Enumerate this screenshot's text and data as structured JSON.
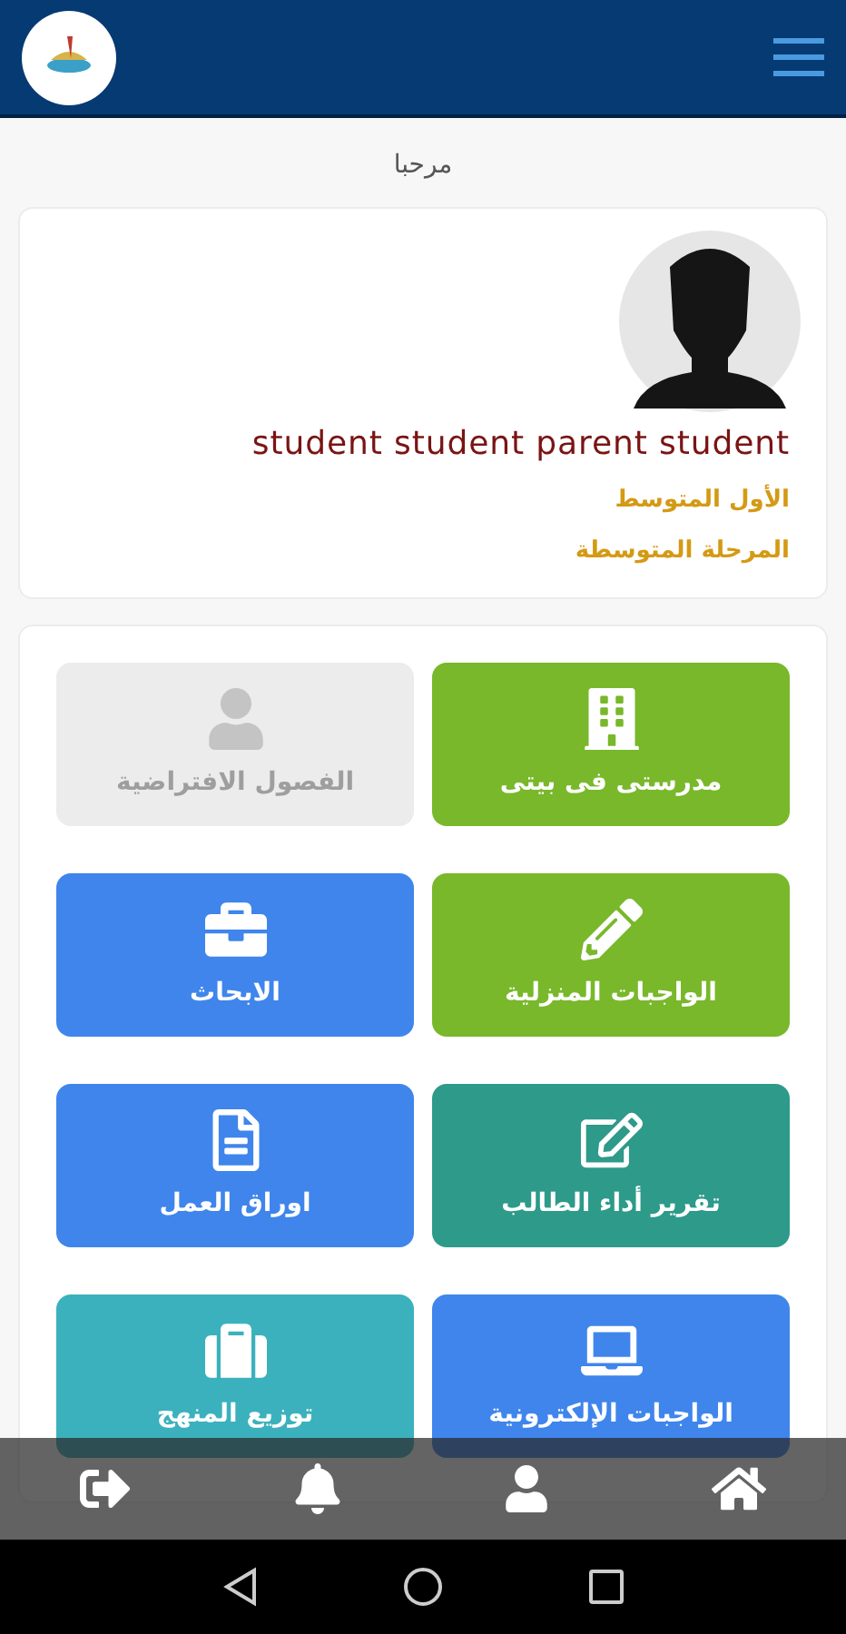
{
  "greeting": "مرحبا",
  "profile": {
    "name": "student student parent student",
    "grade": "الأول المتوسط",
    "stage": "المرحلة المتوسطة"
  },
  "tiles": [
    {
      "label": "مدرستى فى بيتى",
      "color": "#78b82a",
      "disabled": false
    },
    {
      "label": "الفصول الافتراضية",
      "color": "#ececec",
      "disabled": true
    },
    {
      "label": "الواجبات المنزلية",
      "color": "#78b82a",
      "disabled": false
    },
    {
      "label": "الابحاث",
      "color": "#3f85ec",
      "disabled": false
    },
    {
      "label": "تقرير أداء الطالب",
      "color": "#2d9a8a",
      "disabled": false
    },
    {
      "label": "اوراق العمل",
      "color": "#3f85ec",
      "disabled": false
    },
    {
      "label": "الواجبات الإلكترونية",
      "color": "#3f85ec",
      "disabled": false
    },
    {
      "label": "توزيع المنهج",
      "color": "#3bb1bd",
      "disabled": false
    }
  ]
}
